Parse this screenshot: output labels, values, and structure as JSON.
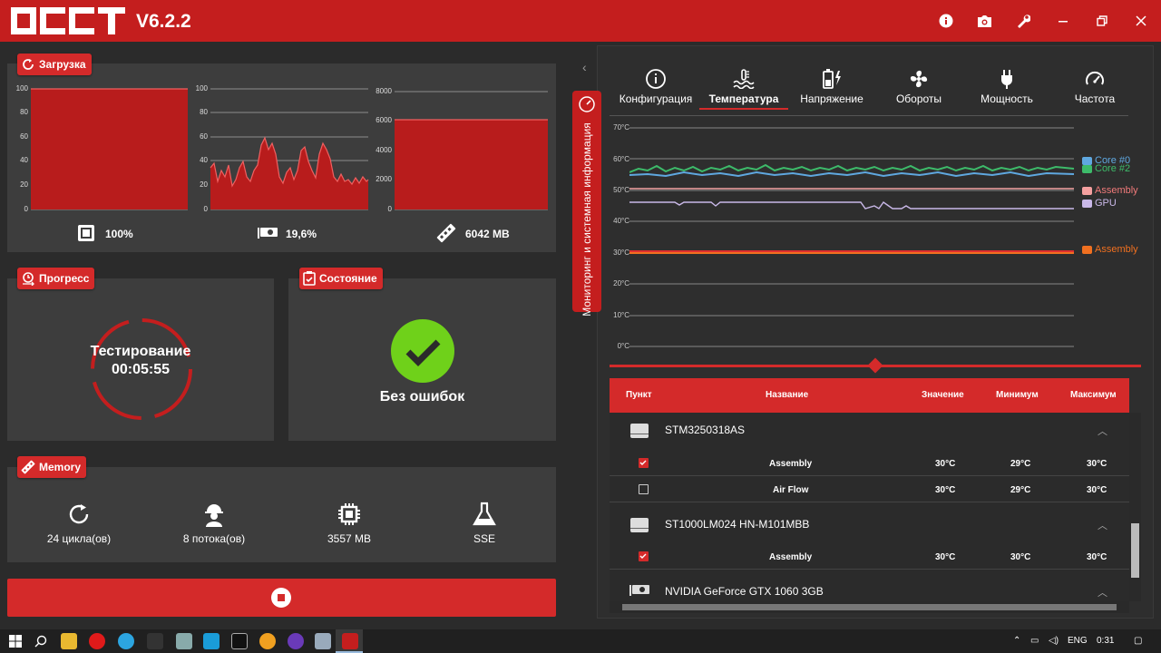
{
  "app": {
    "version": "V6.2.2",
    "accent": "#c41e1e"
  },
  "titlebar": {
    "icons": [
      "info-icon",
      "camera-icon",
      "wrench-icon",
      "restore-icon",
      "close-icon"
    ]
  },
  "load": {
    "title": "Загрузка",
    "cpu": {
      "value": "100%",
      "yaxis": [
        "100",
        "80",
        "60",
        "40",
        "20",
        "0"
      ]
    },
    "gpu": {
      "value": "19,6%",
      "yaxis": [
        "100",
        "80",
        "60",
        "40",
        "20",
        "0"
      ]
    },
    "ram": {
      "value": "6042 MB",
      "yaxis": [
        "8000",
        "6000",
        "4000",
        "2000",
        "0"
      ]
    }
  },
  "progress": {
    "title": "Прогресс",
    "status": "Тестирование",
    "time": "00:05:55"
  },
  "state": {
    "title": "Состояние",
    "result": "Без ошибок"
  },
  "memory": {
    "title": "Memory",
    "cycles": "24 цикла(ов)",
    "threads": "8 потока(ов)",
    "size": "3557 MB",
    "instr": "SSE"
  },
  "side_tab": "Мониторинг и системная информация",
  "tabs": [
    "Конфигурация",
    "Температура",
    "Напряжение",
    "Обороты",
    "Мощность",
    "Частота"
  ],
  "chart_data": {
    "type": "line",
    "ylabels": [
      "70°C",
      "60°C",
      "50°C",
      "40°C",
      "30°C",
      "20°C",
      "10°C",
      "0°C"
    ],
    "ylim": [
      0,
      70
    ],
    "legend": [
      {
        "name": "Core #0",
        "color": "#5fa8e0"
      },
      {
        "name": "Core #2",
        "color": "#3dbb6a"
      },
      {
        "name": "Assembly",
        "color": "#f07a7a"
      },
      {
        "name": "GPU",
        "color": "#c9b8e8"
      },
      {
        "name": "Assembly",
        "color": "#f07020"
      }
    ]
  },
  "table": {
    "headers": [
      "Пункт",
      "Название",
      "Значение",
      "Минимум",
      "Максимум"
    ],
    "groups": [
      {
        "name": "STM3250318AS",
        "rows": [
          {
            "checked": true,
            "name": "Assembly",
            "value": "30°C",
            "min": "29°C",
            "max": "30°C"
          },
          {
            "checked": false,
            "name": "Air Flow",
            "value": "30°C",
            "min": "29°C",
            "max": "30°C"
          }
        ]
      },
      {
        "name": "ST1000LM024 HN-M101MBB",
        "rows": [
          {
            "checked": true,
            "name": "Assembly",
            "value": "30°C",
            "min": "30°C",
            "max": "30°C"
          }
        ]
      },
      {
        "name": "NVIDIA GeForce GTX 1060 3GB",
        "rows": []
      }
    ]
  },
  "taskbar": {
    "lang": "ENG",
    "time": "0:31"
  }
}
